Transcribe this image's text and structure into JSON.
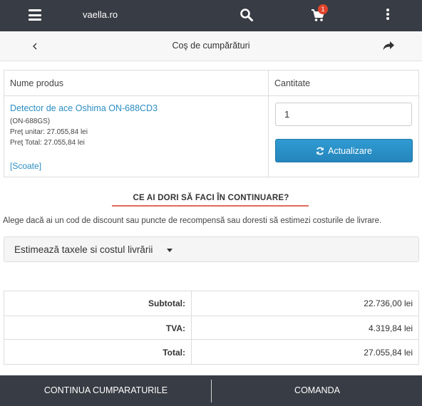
{
  "header": {
    "brand": "vaella.ro",
    "cart_count": "1",
    "icons": [
      "menu-icon",
      "search-icon",
      "cart-icon",
      "kebab-menu-icon"
    ]
  },
  "subheader": {
    "title": "Coş de cumpărături",
    "icons": [
      "back-icon",
      "share-icon"
    ]
  },
  "cart_table": {
    "col_product": "Nume produs",
    "col_quantity": "Cantitate",
    "item": {
      "name": "Detector de ace Oshima ON-688CD3",
      "model": "(ON-688GS)",
      "unit_price": "Preţ unitar: 27.055,84 lei",
      "total_price": "Preţ Total: 27.055,84 lei",
      "remove": "[Scoate]",
      "quantity": "1"
    },
    "update_label": "Actualizare"
  },
  "next_section": {
    "heading": "CE AI DORI SĂ FACI ÎN CONTINUARE?",
    "description": "Alege dacă ai un cod de discount sau puncte de recompensă sau doresti să estimezi costurile de livrare.",
    "estimate_label": "Estimează taxele si costul livrării"
  },
  "totals": [
    {
      "label": "Subtotal:",
      "value": "22.736,00 lei"
    },
    {
      "label": "TVA:",
      "value": "4.319,84 lei"
    },
    {
      "label": "Total:",
      "value": "27.055,84 lei"
    }
  ],
  "footer": {
    "continue_label": "CONTINUA CUMPARATURILE",
    "checkout_label": "COMANDA"
  },
  "colors": {
    "header_bg": "#383c44",
    "link": "#2a8ec2",
    "button_primary": "#2585bc",
    "badge": "#e0422a",
    "underline_accent": "#e26a5a"
  }
}
